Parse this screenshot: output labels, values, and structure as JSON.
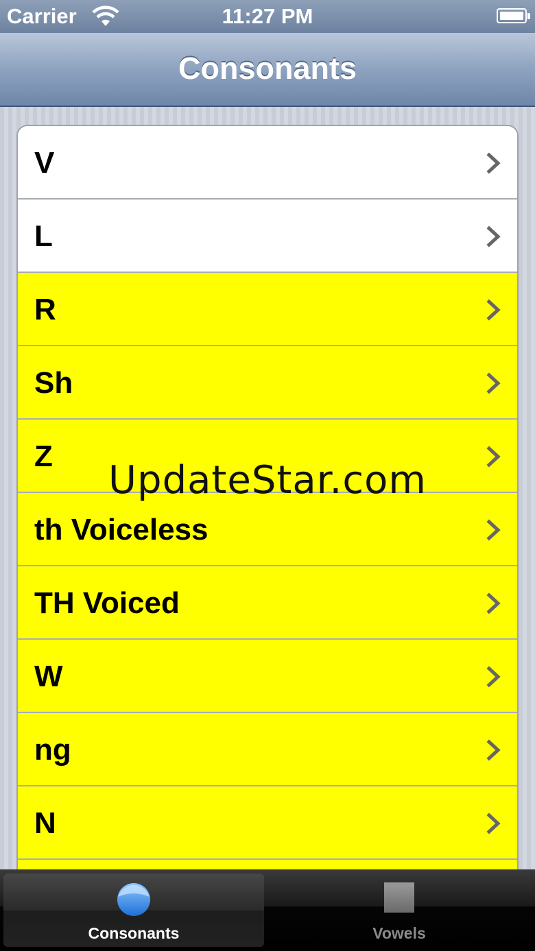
{
  "status_bar": {
    "carrier": "Carrier",
    "time": "11:27 PM"
  },
  "nav": {
    "title": "Consonants"
  },
  "rows": [
    {
      "label": "V",
      "highlighted": false
    },
    {
      "label": "L",
      "highlighted": false
    },
    {
      "label": "R",
      "highlighted": true
    },
    {
      "label": "Sh",
      "highlighted": true
    },
    {
      "label": "Z",
      "highlighted": true
    },
    {
      "label": "th Voiceless",
      "highlighted": true
    },
    {
      "label": "TH Voiced",
      "highlighted": true
    },
    {
      "label": "W",
      "highlighted": true
    },
    {
      "label": "ng",
      "highlighted": true
    },
    {
      "label": "N",
      "highlighted": true
    }
  ],
  "watermark": "UpdateStar.com",
  "tab_bar": {
    "tabs": [
      {
        "label": "Consonants",
        "selected": true,
        "icon": "blue-circle-icon"
      },
      {
        "label": "Vowels",
        "selected": false,
        "icon": "gray-square-icon"
      }
    ]
  },
  "colors": {
    "highlight": "#ffff00",
    "nav": "#8ea3c0",
    "tab_icon_blue": "#3b8fe6"
  }
}
